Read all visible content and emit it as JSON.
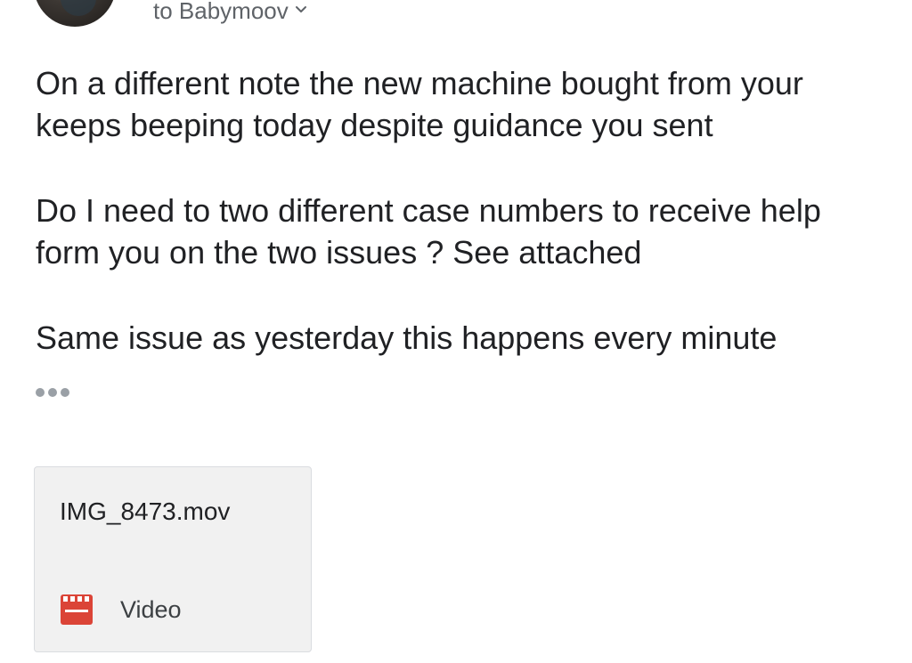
{
  "header": {
    "recipient_label": "to Babymoov"
  },
  "message": {
    "paragraphs": [
      "On a different note the new machine bought from your keeps beeping today despite guidance you sent",
      "Do I need to two different case numbers to receive help form you on the two issues ? See attached",
      "Same issue as yesterday this happens every minute"
    ]
  },
  "attachment": {
    "filename": "IMG_8473.mov",
    "type_label": "Video",
    "icon": "video-clapperboard-icon",
    "icon_color": "#db4437"
  },
  "colors": {
    "text": "#202124",
    "secondary_text": "#5f6368",
    "attachment_bg": "#f1f1f1"
  }
}
